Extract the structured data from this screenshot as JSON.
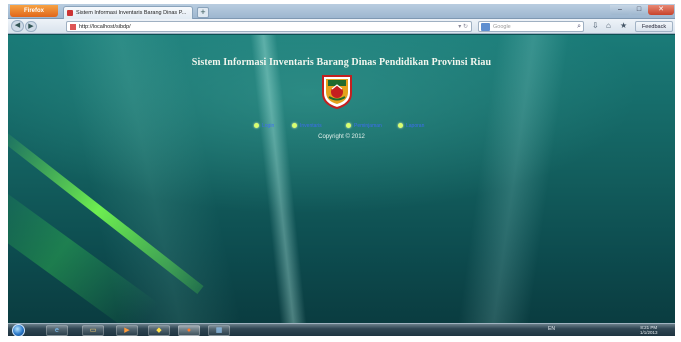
{
  "browser": {
    "firefox_button_label": "Firefox",
    "tab_title": "Sistem Informasi Inventaris Barang Dinas P...",
    "new_tab_label": "+",
    "url": "http://localhost/sibdp/",
    "search_placeholder": "Google",
    "feedback_label": "Feedback",
    "window_controls": {
      "minimize": "–",
      "maximize": "□",
      "close": "✕"
    },
    "nav": {
      "back": "◀",
      "forward": "▶"
    },
    "icons": {
      "download": "⇩",
      "home": "⌂",
      "bookmarks": "★",
      "search": "⌕"
    }
  },
  "page": {
    "title": "Sistem Informasi Inventaris Barang Dinas Pendidikan Provinsi Riau",
    "menu": [
      {
        "label": "Login"
      },
      {
        "label": "Inventaris"
      },
      {
        "label": "Peminjaman"
      },
      {
        "label": "Laporan"
      }
    ],
    "copyright": "Copyright © 2012"
  },
  "taskbar": {
    "apps": [
      {
        "name": "internet-explorer",
        "glyph": "e"
      },
      {
        "name": "windows-explorer",
        "glyph": "▭"
      },
      {
        "name": "media-player",
        "glyph": "▶"
      },
      {
        "name": "app",
        "glyph": "◆"
      },
      {
        "name": "firefox",
        "glyph": "●"
      },
      {
        "name": "app",
        "glyph": "▦"
      }
    ],
    "tray_label": "EN",
    "clock_time": "8:21 PM",
    "clock_date": "1/1/2013"
  },
  "colors": {
    "menu_link": "#3d6cf0",
    "menu_bullet": "#d8ff70",
    "background": "#13605f",
    "title_text": "#f2f6ee"
  }
}
